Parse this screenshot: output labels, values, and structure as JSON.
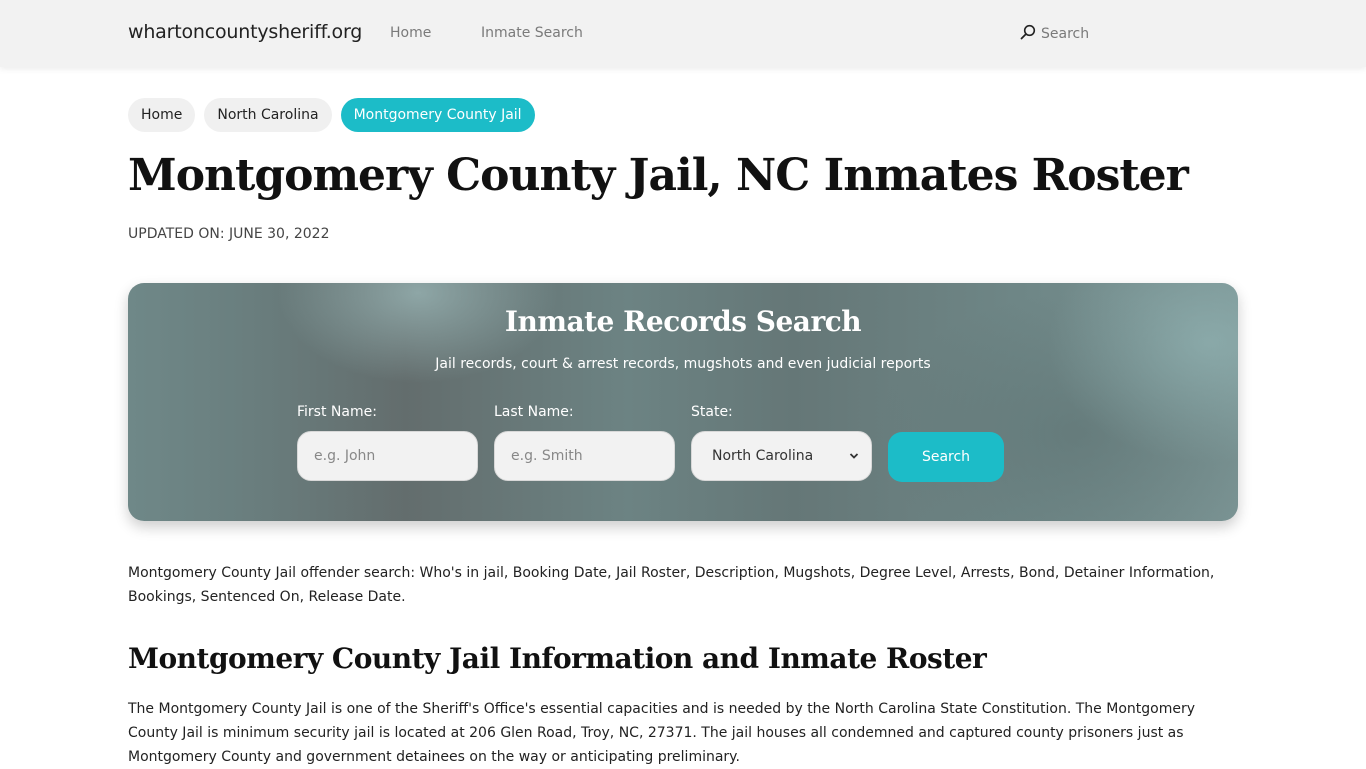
{
  "navbar": {
    "brand": "whartoncountysheriff.org",
    "links": [
      {
        "label": "Home"
      },
      {
        "label": "Inmate Search"
      }
    ],
    "search_label": "Search",
    "search_icon": "search-icon"
  },
  "breadcrumb": [
    {
      "label": "Home"
    },
    {
      "label": "North Carolina"
    },
    {
      "label": "Montgomery County Jail",
      "active": true
    }
  ],
  "page": {
    "title": "Montgomery County Jail, NC Inmates Roster",
    "updated": "UPDATED ON: JUNE 30, 2022"
  },
  "hero": {
    "title": "Inmate Records Search",
    "subtitle": "Jail records, court & arrest records, mugshots and even judicial reports",
    "first_name_label": "First Name:",
    "first_name_placeholder": "e.g. John",
    "first_name_value": "",
    "last_name_label": "Last Name:",
    "last_name_placeholder": "e.g. Smith",
    "last_name_value": "",
    "state_label": "State:",
    "state_selected": "North Carolina",
    "search_button": "Search"
  },
  "content": {
    "intro": "Montgomery County Jail offender search: Who's in jail, Booking Date, Jail Roster, Description, Mugshots, Degree Level, Arrests, Bond, Detainer Information, Bookings, Sentenced On, Release Date.",
    "section_title": "Montgomery County Jail Information and Inmate Roster",
    "section_body": "The Montgomery County Jail is one of the Sheriff's Office's essential capacities and is needed by the North Carolina State Constitution. The Montgomery County Jail is minimum security jail is located at 206 Glen Road, Troy, NC, 27371. The jail houses all condemned and captured county prisoners just as Montgomery County and government detainees on the way or anticipating preliminary."
  },
  "colors": {
    "accent": "#1cbcc8",
    "navbar_bg": "#f2f2f2",
    "hero_bg": "#6a7f7f"
  }
}
